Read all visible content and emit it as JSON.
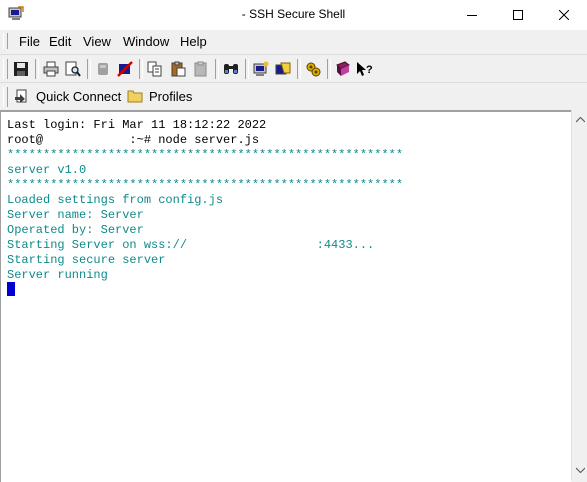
{
  "window": {
    "title": "- SSH Secure Shell",
    "icon": "ssh-app-icon",
    "controls": [
      "minimize-icon",
      "maximize-icon",
      "close-icon"
    ]
  },
  "menu": {
    "items": [
      {
        "label": "File"
      },
      {
        "label": "Edit"
      },
      {
        "label": "View"
      },
      {
        "label": "Window"
      },
      {
        "label": "Help"
      }
    ]
  },
  "toolbar": {
    "icons": [
      "save-icon",
      "print-icon",
      "print-preview-icon",
      "disconnect-icon",
      "settings-disabled-icon",
      "copy-icon",
      "paste-icon",
      "paste-disabled-icon",
      "find-icon",
      "new-terminal-icon",
      "new-file-transfer-icon",
      "profile-settings-icon",
      "help-book-icon",
      "whats-this-help-icon"
    ]
  },
  "quickbar": {
    "quick_connect_label": "Quick Connect",
    "profiles_label": "Profiles"
  },
  "terminal": {
    "lines": [
      {
        "text": "Last login: Fri Mar 11 18:12:22 2022",
        "color": "black"
      },
      {
        "text": "root@            :~# node server.js",
        "color": "black"
      },
      {
        "text": "*******************************************************",
        "color": "teal"
      },
      {
        "text": "server v1.0",
        "color": "teal"
      },
      {
        "text": "*******************************************************",
        "color": "teal"
      },
      {
        "text": "Loaded settings from config.js",
        "color": "teal"
      },
      {
        "text": "Server name: Server",
        "color": "teal"
      },
      {
        "text": "Operated by: Server",
        "color": "teal"
      },
      {
        "text": "Starting Server on wss://                  :4433...",
        "color": "teal"
      },
      {
        "text": "Starting secure server",
        "color": "teal"
      },
      {
        "text": "Server running",
        "color": "teal"
      }
    ]
  },
  "colors": {
    "terminal_text": "#000000",
    "terminal_output": "#0f8a8a",
    "cursor": "#0000d0"
  }
}
